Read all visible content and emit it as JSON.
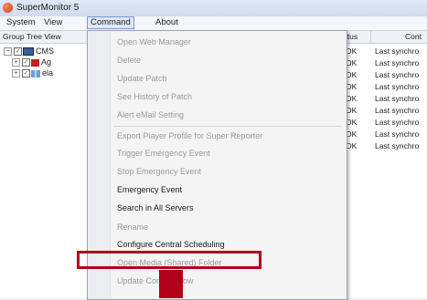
{
  "window": {
    "title": "SuperMonitor 5"
  },
  "menubar": {
    "items": [
      "System",
      "View",
      "Command",
      "About"
    ],
    "active": "Command"
  },
  "tree": {
    "header": "Group Tree View",
    "rows": [
      {
        "expander": "−",
        "label": "CMS"
      },
      {
        "expander": "+",
        "label": "Ag"
      },
      {
        "expander": "+",
        "label": "ela"
      }
    ]
  },
  "list": {
    "columns": {
      "status": "atus",
      "content": "Cont"
    },
    "rows": [
      {
        "status": "OK",
        "content": "Last synchro"
      },
      {
        "status": "OK",
        "content": "Last synchro"
      },
      {
        "status": "OK",
        "content": "Last synchro"
      },
      {
        "status": "OK",
        "content": "Last synchro"
      },
      {
        "status": "OK",
        "content": "Last synchro"
      },
      {
        "status": "OK",
        "content": "Last synchro"
      },
      {
        "status": "OK",
        "content": "Last synchro"
      },
      {
        "status": "OK",
        "content": "Last synchro"
      },
      {
        "status": "OK",
        "content": "Last synchro"
      }
    ]
  },
  "command_menu": {
    "items": [
      {
        "label": "Open Web Manager",
        "enabled": false
      },
      {
        "label": "Delete",
        "enabled": false
      },
      {
        "label": "Update Patch",
        "enabled": false
      },
      {
        "label": "See History of Patch",
        "enabled": false
      },
      {
        "label": "Alert eMail Setting",
        "enabled": false
      },
      {
        "label": "Export Player Profile for Super Reporter",
        "enabled": false
      },
      {
        "label": "Trigger Emergency Event",
        "enabled": false
      },
      {
        "label": "Stop Emergency Event",
        "enabled": false
      },
      {
        "label": "Emergency Event",
        "enabled": true
      },
      {
        "label": "Search in All Servers",
        "enabled": true
      },
      {
        "label": "Rename",
        "enabled": false
      },
      {
        "label": "Configure Central Scheduling",
        "enabled": true
      },
      {
        "label": "Open Media (Shared) Folder",
        "enabled": false
      },
      {
        "label": "Update Content Now",
        "enabled": false
      }
    ]
  },
  "colors": {
    "highlight_frame": "#b3001a",
    "disabled_text": "#9a9a9a"
  }
}
